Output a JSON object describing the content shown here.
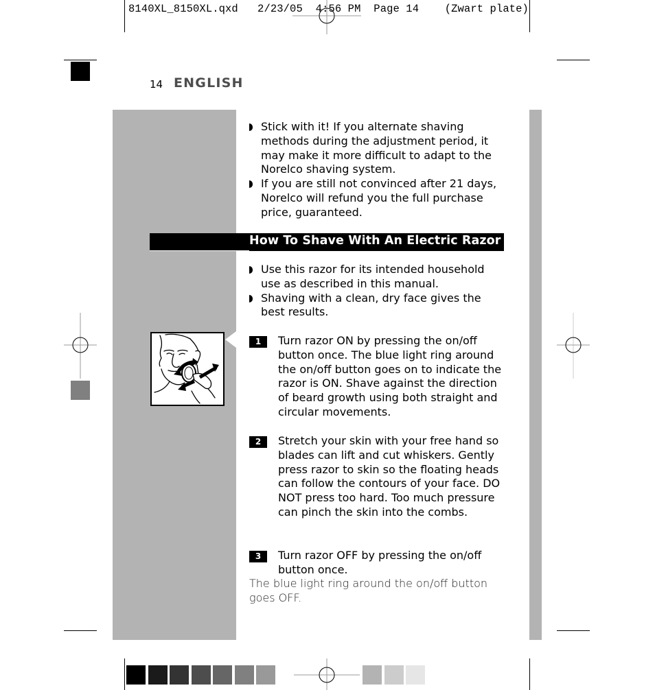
{
  "slug_line": {
    "file": "8140XL_8150XL.qxd",
    "date": "2/23/05",
    "time": "4:56 PM",
    "page": "Page 14",
    "plate": "(Zwart plate)"
  },
  "header": {
    "page_number": "14",
    "language": "ENGLISH"
  },
  "intro_bullets": [
    "Stick with it! If you alternate shaving methods during the adjustment period, it may make it more difficult to adapt to the Norelco shaving system.",
    "If you are still not convinced after 21 days, Norelco will refund you the full purchase price, guaranteed."
  ],
  "section": {
    "title": "How To Shave With An Electric Razor",
    "bullets": [
      "Use this razor for its intended household use as described in this manual.",
      "Shaving with a clean, dry face gives the best results."
    ],
    "steps": [
      {
        "number": "1",
        "text": "Turn razor ON by pressing the on/off button once. The blue light ring around the on/off button goes on to indicate the razor is ON. Shave against the direction of beard growth using both straight and circular movements."
      },
      {
        "number": "2",
        "text": "Stretch your skin with your free hand so blades can lift and cut whiskers. Gently press razor to skin so the floating heads can follow the contours of your face. DO NOT press too hard. Too much pressure can pinch the skin into the combs."
      },
      {
        "number": "3",
        "text": "Turn razor OFF by pressing the on/off button once."
      }
    ],
    "note": "The blue light ring around the on/off button goes OFF.",
    "illustration": "man-shaving-with-rotary-razor-illustration"
  },
  "color_bar": {
    "swatches_left": [
      "#000000",
      "#1a1a1a",
      "#333333",
      "#4d4d4d",
      "#666666",
      "#808080",
      "#999999"
    ],
    "swatches_right": [
      "#b3b3b3",
      "#cccccc",
      "#e6e6e6"
    ]
  }
}
